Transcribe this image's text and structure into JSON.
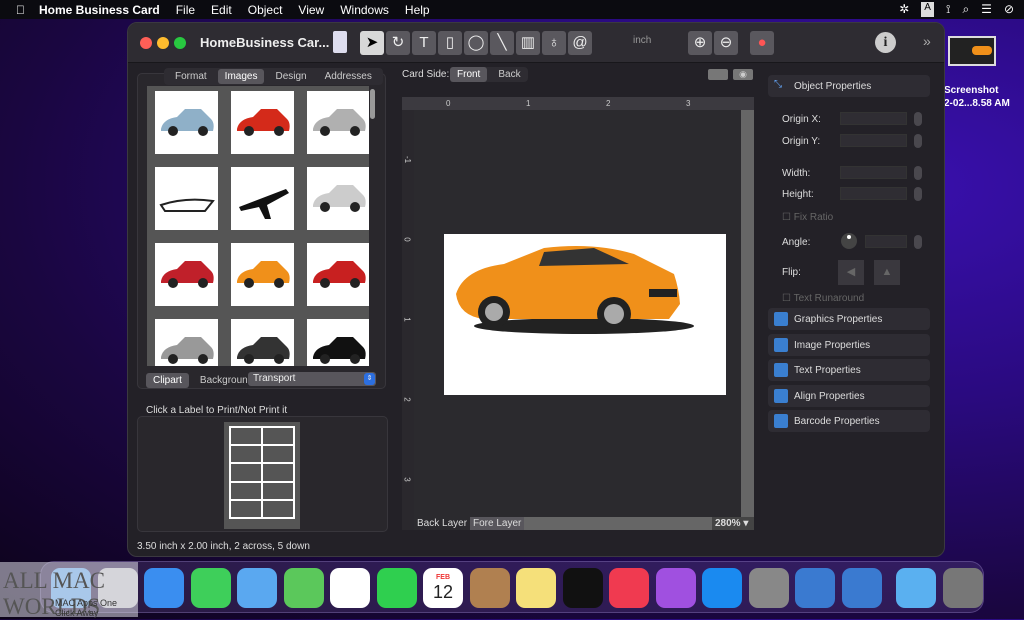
{
  "menubar": {
    "app": "Home Business Card",
    "items": [
      "File",
      "Edit",
      "Object",
      "View",
      "Windows",
      "Help"
    ]
  },
  "window": {
    "title": "HomeBusiness Car...",
    "unit": "inch"
  },
  "left": {
    "tabs": [
      "Format",
      "Images",
      "Design",
      "Addresses"
    ],
    "active_tab": "Images",
    "thumbs": [
      {
        "kind": "car",
        "color": "#8fb0c8"
      },
      {
        "kind": "car",
        "color": "#d42a1a"
      },
      {
        "kind": "suv",
        "color": "#b0b0b0"
      },
      {
        "kind": "boat",
        "color": "#222"
      },
      {
        "kind": "plane",
        "color": "#111"
      },
      {
        "kind": "truck",
        "color": "#ccc"
      },
      {
        "kind": "car",
        "color": "#c0202a"
      },
      {
        "kind": "car",
        "color": "#f0901a"
      },
      {
        "kind": "car",
        "color": "#c82020"
      },
      {
        "kind": "suv",
        "color": "#999"
      },
      {
        "kind": "buggy",
        "color": "#333"
      },
      {
        "kind": "car",
        "color": "#111"
      }
    ],
    "mode_tabs": [
      "Clipart",
      "Background"
    ],
    "category": "Transport",
    "print_hint": "Click a Label to Print/Not Print it",
    "status": "3.50 inch x 2.00 inch, 2 across, 5 down"
  },
  "center": {
    "card_side_label": "Card Side:",
    "sides": [
      "Front",
      "Back"
    ],
    "active_side": "Front",
    "ruler_h": [
      "0",
      "1",
      "2",
      "3"
    ],
    "ruler_v": [
      "-1",
      "0",
      "1",
      "2",
      "3"
    ],
    "layers": [
      "Back Layer",
      "Fore Layer"
    ],
    "active_layer": "Fore Layer",
    "zoom": "280%"
  },
  "right": {
    "object_properties": "Object Properties",
    "origin_x": "Origin X:",
    "origin_y": "Origin Y:",
    "width": "Width:",
    "height": "Height:",
    "fix_ratio": "Fix Ratio",
    "angle": "Angle:",
    "flip": "Flip:",
    "text_runaround": "Text Runaround",
    "sections": [
      "Graphics Properties",
      "Image Properties",
      "Text Properties",
      "Align Properties",
      "Barcode Properties"
    ]
  },
  "desktop": {
    "screenshot_line1": "Screenshot",
    "screenshot_line2": "2-02...8.58 AM"
  },
  "dock": {
    "calendar_month": "FEB",
    "calendar_day": "12",
    "apps": [
      "Finder",
      "Launchpad",
      "Safari",
      "Messages",
      "Mail",
      "Maps",
      "Photos",
      "FaceTime",
      "Calendar",
      "Contacts",
      "Notes",
      "TV",
      "Music",
      "Podcasts",
      "App Store",
      "System Preferences",
      "Mountain",
      "Home Business Card",
      "Downloads",
      "Trash"
    ]
  },
  "watermark": {
    "title": "ALL MAC WORLDS",
    "tagline": "MAC Apps One Click Away"
  }
}
